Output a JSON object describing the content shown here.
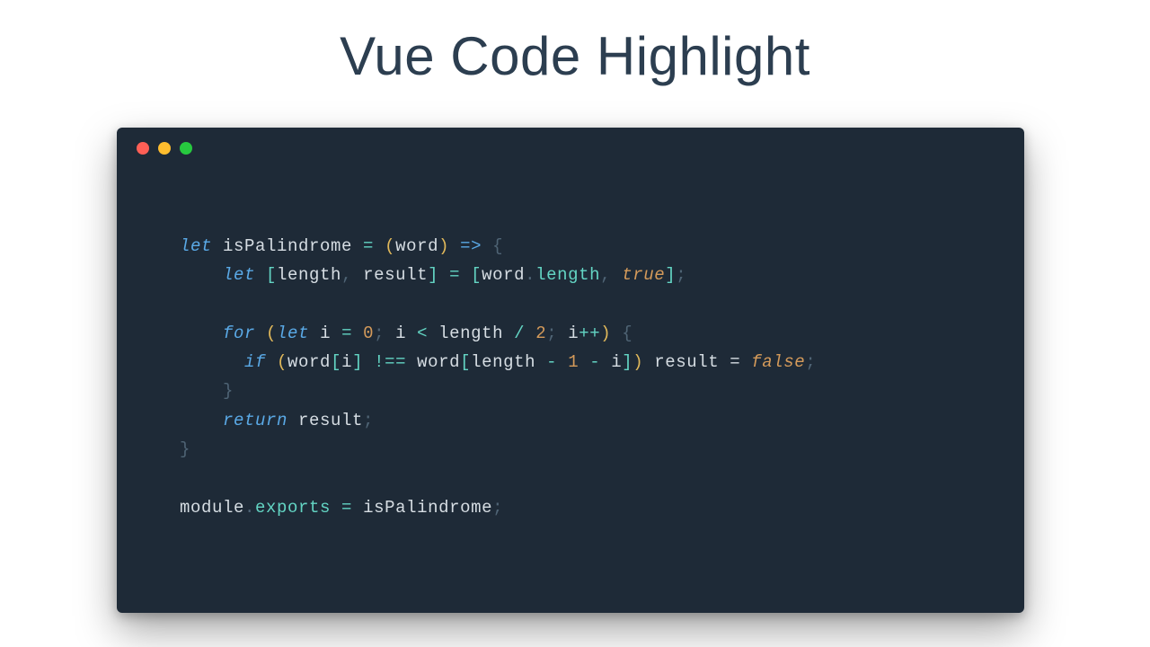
{
  "title": "Vue Code Highlight",
  "traffic_lights": [
    "close",
    "minimize",
    "zoom"
  ],
  "code": {
    "tokens": [
      [
        {
          "t": "let ",
          "c": "kw"
        },
        {
          "t": "isPalindrome ",
          "c": "var"
        },
        {
          "t": "= ",
          "c": "op"
        },
        {
          "t": "(",
          "c": "par"
        },
        {
          "t": "word",
          "c": "var"
        },
        {
          "t": ") ",
          "c": "par"
        },
        {
          "t": "=> ",
          "c": "arrw"
        },
        {
          "t": "{",
          "c": "brc"
        }
      ],
      [
        {
          "t": "    ",
          "c": "pun"
        },
        {
          "t": "let ",
          "c": "kw"
        },
        {
          "t": "[",
          "c": "brk"
        },
        {
          "t": "length",
          "c": "var"
        },
        {
          "t": ", ",
          "c": "pun"
        },
        {
          "t": "result",
          "c": "var"
        },
        {
          "t": "] ",
          "c": "brk"
        },
        {
          "t": "= ",
          "c": "op"
        },
        {
          "t": "[",
          "c": "brk"
        },
        {
          "t": "word",
          "c": "var"
        },
        {
          "t": ".",
          "c": "pun"
        },
        {
          "t": "length",
          "c": "prop"
        },
        {
          "t": ", ",
          "c": "pun"
        },
        {
          "t": "true",
          "c": "bool"
        },
        {
          "t": "]",
          "c": "brk"
        },
        {
          "t": ";",
          "c": "pun"
        }
      ],
      [],
      [
        {
          "t": "    ",
          "c": "pun"
        },
        {
          "t": "for ",
          "c": "kw"
        },
        {
          "t": "(",
          "c": "par"
        },
        {
          "t": "let ",
          "c": "kw"
        },
        {
          "t": "i ",
          "c": "var"
        },
        {
          "t": "= ",
          "c": "op"
        },
        {
          "t": "0",
          "c": "num"
        },
        {
          "t": "; ",
          "c": "pun"
        },
        {
          "t": "i ",
          "c": "var"
        },
        {
          "t": "< ",
          "c": "op"
        },
        {
          "t": "length ",
          "c": "var"
        },
        {
          "t": "/ ",
          "c": "op"
        },
        {
          "t": "2",
          "c": "num"
        },
        {
          "t": "; ",
          "c": "pun"
        },
        {
          "t": "i",
          "c": "var"
        },
        {
          "t": "++",
          "c": "op"
        },
        {
          "t": ") ",
          "c": "par"
        },
        {
          "t": "{",
          "c": "brc"
        }
      ],
      [
        {
          "t": "      ",
          "c": "pun"
        },
        {
          "t": "if ",
          "c": "kw"
        },
        {
          "t": "(",
          "c": "par"
        },
        {
          "t": "word",
          "c": "var"
        },
        {
          "t": "[",
          "c": "brk"
        },
        {
          "t": "i",
          "c": "var"
        },
        {
          "t": "] ",
          "c": "brk"
        },
        {
          "t": "!== ",
          "c": "op"
        },
        {
          "t": "word",
          "c": "var"
        },
        {
          "t": "[",
          "c": "brk"
        },
        {
          "t": "length ",
          "c": "var"
        },
        {
          "t": "- ",
          "c": "op"
        },
        {
          "t": "1 ",
          "c": "num"
        },
        {
          "t": "- ",
          "c": "op"
        },
        {
          "t": "i",
          "c": "var"
        },
        {
          "t": "]",
          "c": "brk"
        },
        {
          "t": ") ",
          "c": "par"
        },
        {
          "t": "result ",
          "c": "var"
        },
        {
          "t": "= ",
          "c": "opw"
        },
        {
          "t": "false",
          "c": "bool"
        },
        {
          "t": ";",
          "c": "pun"
        }
      ],
      [
        {
          "t": "    ",
          "c": "pun"
        },
        {
          "t": "}",
          "c": "brc"
        }
      ],
      [
        {
          "t": "    ",
          "c": "pun"
        },
        {
          "t": "return ",
          "c": "kw"
        },
        {
          "t": "result",
          "c": "var"
        },
        {
          "t": ";",
          "c": "pun"
        }
      ],
      [
        {
          "t": "}",
          "c": "brc"
        }
      ],
      [],
      [
        {
          "t": "module",
          "c": "var"
        },
        {
          "t": ".",
          "c": "pun"
        },
        {
          "t": "exports ",
          "c": "prop"
        },
        {
          "t": "= ",
          "c": "op"
        },
        {
          "t": "isPalindrome",
          "c": "var"
        },
        {
          "t": ";",
          "c": "pun"
        }
      ]
    ]
  }
}
